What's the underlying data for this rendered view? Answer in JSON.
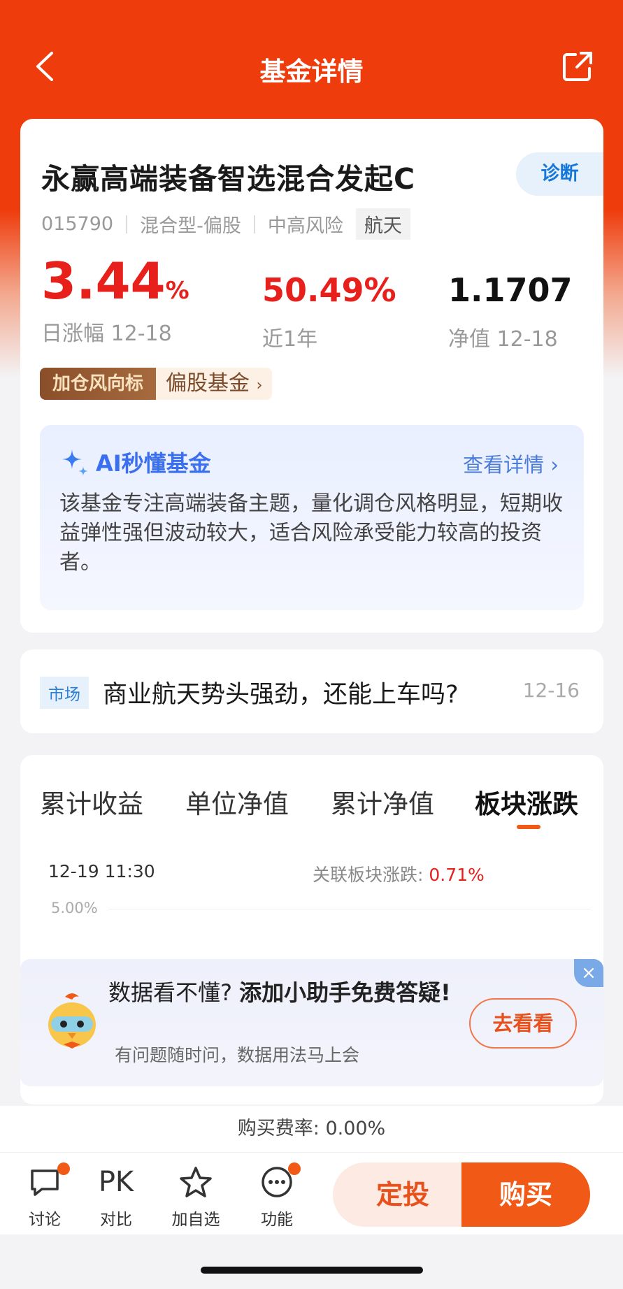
{
  "header": {
    "title": "基金详情"
  },
  "fund": {
    "name": "永赢高端装备智选混合发起C",
    "diagnose": "诊断",
    "code": "015790",
    "type": "混合型-偏股",
    "risk": "中高风险",
    "theme_tag": "航天",
    "daily_change": "3.44",
    "daily_change_unit": "%",
    "daily_change_label": "日涨幅 12-18",
    "year_change": "50.49%",
    "year_change_label": "近1年",
    "nav": "1.1707",
    "nav_label": "净值 12-18",
    "wind_badge": "加仓风向标",
    "wind_text": "偏股基金",
    "wind_chevron": "›"
  },
  "ai": {
    "title": "AI秒懂基金",
    "more": "查看详情 ›",
    "desc": "该基金专注高端装备主题，量化调仓风格明显，短期收益弹性强但波动较大，适合风险承受能力较高的投资者。"
  },
  "news": {
    "tag": "市场",
    "title": "商业航天势头强劲，还能上车吗?",
    "date": "12-16"
  },
  "chart": {
    "tabs": [
      "累计收益",
      "单位净值",
      "累计净值",
      "板块涨跌"
    ],
    "active_tab": 3,
    "time": "12-19 11:30",
    "sector_label": "关联板块涨跌: ",
    "sector_value": "0.71%",
    "y_label": "5.00%"
  },
  "helper": {
    "close": "×",
    "title_plain": "数据看不懂? ",
    "title_bold": "添加小助手免费答疑!",
    "sub": "有问题随时问，数据用法马上会",
    "button": "去看看"
  },
  "fee": {
    "text": "购买费率: 0.00%"
  },
  "bottom": {
    "discuss": "讨论",
    "compare_icon": "PK",
    "compare": "对比",
    "watch": "加自选",
    "function": "功能",
    "auto_invest": "定投",
    "buy": "购买"
  },
  "colors": {
    "brand": "#ee3c0c",
    "rise": "#e8201c",
    "accent": "#f05a16"
  }
}
